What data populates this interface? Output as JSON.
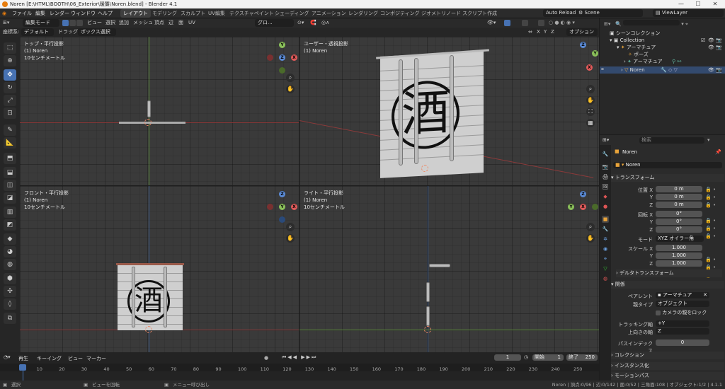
{
  "window": {
    "title": "Noren [E:\\HTML\\BOOTH\\06_Exterior\\暖簾\\Noren.blend] - Blender 4.1",
    "min": "—",
    "max": "☐",
    "close": "✕"
  },
  "menu": [
    "ファイル",
    "編集",
    "レンダー",
    "ウィンドウ",
    "ヘルプ"
  ],
  "workspaces": [
    "レイアウト",
    "モデリング",
    "スカルプト",
    "UV編集",
    "テクスチャペイント",
    "シェーディング",
    "アニメーション",
    "レンダリング",
    "コンポジティング",
    "ジオメトリノード",
    "スクリプト作成"
  ],
  "active_workspace": "レイアウト",
  "top_right": {
    "auto_reload": "Auto Reload",
    "scene": "Scene",
    "view_layer": "ViewLayer"
  },
  "header": {
    "mode": "編集モード",
    "items": [
      "ビュー",
      "選択",
      "追加",
      "メッシュ",
      "頂点",
      "辺",
      "面",
      "UV"
    ],
    "orientation": "グロ...",
    "options": "オプション"
  },
  "header2": {
    "coord_label": "座標系:",
    "coord": "デフォルト",
    "drag_label": "ドラッグ...",
    "drag": "ボックス選択",
    "xyz": [
      "X",
      "Y",
      "Z"
    ]
  },
  "viewports": [
    {
      "name": "トップ・平行投影",
      "object": "(1) Noren",
      "scale": "10センチメートル"
    },
    {
      "name": "ユーザー・透視投影",
      "object": "(1) Noren",
      "scale": ""
    },
    {
      "name": "フロント・平行投影",
      "object": "(1) Noren",
      "scale": "10センチメートル"
    },
    {
      "name": "ライト・平行投影",
      "object": "(1) Noren",
      "scale": "10センチメートル"
    }
  ],
  "kanji": "酒",
  "gizmo": {
    "x": "X",
    "y": "Y",
    "z": "Z"
  },
  "outliner": {
    "items": [
      {
        "label": "シーンコレクション"
      },
      {
        "label": "Collection"
      },
      {
        "label": "アーマチュア"
      },
      {
        "label": "ポーズ"
      },
      {
        "label": "アーマチュア"
      },
      {
        "label": "Noren"
      }
    ]
  },
  "props": {
    "search_placeholder": "検索",
    "object_name": "Noren",
    "object_name2": "Noren",
    "transform": "トランスフォーム",
    "loc_label": "位置 X",
    "loc": [
      "0 m",
      "0 m",
      "0 m"
    ],
    "rot_label": "回転 X",
    "rot": [
      "0°",
      "0°",
      "0°"
    ],
    "mode_label": "モード",
    "mode": "XYZ オイラー角",
    "scale_label": "スケール X",
    "scale": [
      "1.000",
      "1.000",
      "1.000"
    ],
    "y": "Y",
    "z": "Z",
    "delta": "デルタトランスフォーム",
    "relations": "関係",
    "parent_label": "ペアレント",
    "parent": "アーマチュア",
    "parent_type_label": "親タイプ",
    "parent_type": "オブジェクト",
    "camera_parent": "カメラの親をロック",
    "track_label": "トラッキング軸",
    "track": "+Y",
    "up_label": "上向きの軸",
    "up": "Z",
    "pass_label": "パスインデックス",
    "pass": "0",
    "collection": "コレクション",
    "instancing": "インスタンス化",
    "motion_paths": "モーションパス"
  },
  "timeline": {
    "menu": [
      "再生",
      "キーイング",
      "ビュー",
      "マーカー"
    ],
    "current": "1",
    "start_label": "開始",
    "start": "1",
    "end_label": "終了",
    "end": "250",
    "frames": [
      "1",
      "10",
      "20",
      "30",
      "40",
      "50",
      "60",
      "70",
      "80",
      "90",
      "100",
      "110",
      "120",
      "130",
      "140",
      "150",
      "160",
      "170",
      "180",
      "190",
      "200",
      "210",
      "220",
      "230",
      "240",
      "250"
    ]
  },
  "status": {
    "select": "選択",
    "rotate": "ビューを回転",
    "menu": "メニュー呼び出し",
    "stats": "Noren | 頂点:0/96 | 辺:0/142 | 面:0/52 | 三角面:108 | オブジェクト:1/2 | 4.1.1"
  }
}
